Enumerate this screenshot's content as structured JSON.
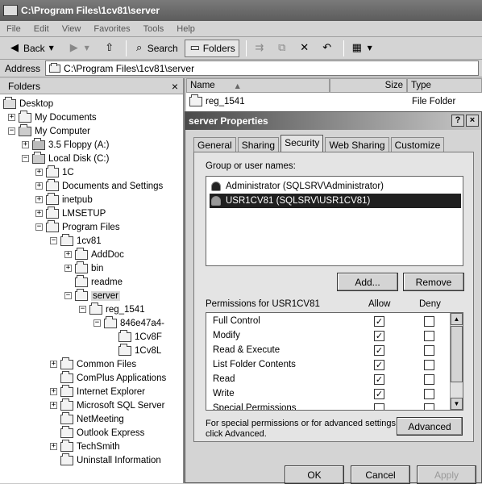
{
  "window": {
    "title": "C:\\Program Files\\1cv81\\server"
  },
  "menu": [
    "File",
    "Edit",
    "View",
    "Favorites",
    "Tools",
    "Help"
  ],
  "toolbar": {
    "back": "Back",
    "search": "Search",
    "folders": "Folders"
  },
  "address": {
    "label": "Address",
    "value": "C:\\Program Files\\1cv81\\server"
  },
  "folders_pane": {
    "title": "Folders",
    "close": "×",
    "tree": [
      {
        "label": "Desktop"
      },
      {
        "label": "My Documents"
      },
      {
        "label": "My Computer"
      },
      {
        "label": "3.5 Floppy (A:)"
      },
      {
        "label": "Local Disk (C:)"
      },
      {
        "label": "1C"
      },
      {
        "label": "Documents and Settings"
      },
      {
        "label": "inetpub"
      },
      {
        "label": "LMSETUP"
      },
      {
        "label": "Program Files"
      },
      {
        "label": "1cv81"
      },
      {
        "label": "AddDoc"
      },
      {
        "label": "bin"
      },
      {
        "label": "readme"
      },
      {
        "label": "server"
      },
      {
        "label": "reg_1541"
      },
      {
        "label": "846e47a4-"
      },
      {
        "label": "1Cv8F"
      },
      {
        "label": "1Cv8L"
      },
      {
        "label": "Common Files"
      },
      {
        "label": "ComPlus Applications"
      },
      {
        "label": "Internet Explorer"
      },
      {
        "label": "Microsoft SQL Server"
      },
      {
        "label": "NetMeeting"
      },
      {
        "label": "Outlook Express"
      },
      {
        "label": "TechSmith"
      },
      {
        "label": "Uninstall Information"
      }
    ]
  },
  "files": {
    "columns": {
      "name": "Name",
      "size": "Size",
      "type": "Type"
    },
    "rows": [
      {
        "name": "reg_1541",
        "type": "File Folder"
      }
    ]
  },
  "dialog": {
    "title": "server Properties",
    "help": "?",
    "close": "×",
    "tabs": [
      "General",
      "Sharing",
      "Security",
      "Web Sharing",
      "Customize"
    ],
    "group_label": "Group or user names:",
    "users": [
      {
        "name": "Administrator (SQLSRV\\Administrator)",
        "selected": false
      },
      {
        "name": "USR1CV81 (SQLSRV\\USR1CV81)",
        "selected": true
      }
    ],
    "add_label": "Add...",
    "remove_label": "Remove",
    "permissions_for": "Permissions for USR1CV81",
    "allow_label": "Allow",
    "deny_label": "Deny",
    "permissions": [
      {
        "name": "Full Control",
        "allow": true,
        "deny": false
      },
      {
        "name": "Modify",
        "allow": true,
        "deny": false
      },
      {
        "name": "Read & Execute",
        "allow": true,
        "deny": false
      },
      {
        "name": "List Folder Contents",
        "allow": true,
        "deny": false
      },
      {
        "name": "Read",
        "allow": true,
        "deny": false
      },
      {
        "name": "Write",
        "allow": true,
        "deny": false
      },
      {
        "name": "Special Permissions",
        "allow": false,
        "deny": false
      }
    ],
    "special_text_1": "For special permissions or for advanced settings,",
    "special_text_2": "click Advanced.",
    "advanced_label": "Advanced",
    "ok_label": "OK",
    "cancel_label": "Cancel",
    "apply_label": "Apply"
  }
}
